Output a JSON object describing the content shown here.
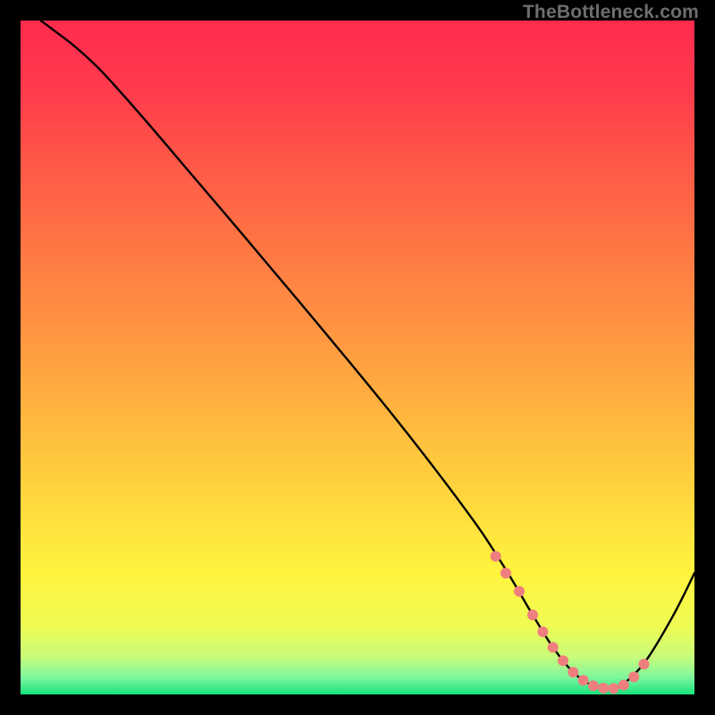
{
  "watermark": "TheBottleneck.com",
  "gradient": {
    "stops": [
      {
        "offset": 0.0,
        "color": "#ff2b4e"
      },
      {
        "offset": 0.1,
        "color": "#ff3a4c"
      },
      {
        "offset": 0.22,
        "color": "#ff5a47"
      },
      {
        "offset": 0.35,
        "color": "#ff7a44"
      },
      {
        "offset": 0.48,
        "color": "#ff9a41"
      },
      {
        "offset": 0.6,
        "color": "#ffba3f"
      },
      {
        "offset": 0.72,
        "color": "#ffda3e"
      },
      {
        "offset": 0.82,
        "color": "#fff43e"
      },
      {
        "offset": 0.9,
        "color": "#eefc55"
      },
      {
        "offset": 0.945,
        "color": "#c7fb7a"
      },
      {
        "offset": 0.975,
        "color": "#7cf79e"
      },
      {
        "offset": 1.0,
        "color": "#18e37a"
      }
    ]
  },
  "chart_data": {
    "type": "line",
    "title": "",
    "xlabel": "",
    "ylabel": "",
    "xlim": [
      0,
      100
    ],
    "ylim": [
      0,
      100
    ],
    "series": [
      {
        "name": "bottleneck-curve",
        "x": [
          3,
          5,
          8,
          12,
          18,
          25,
          33,
          41,
          49,
          56,
          62,
          67.5,
          70,
          73,
          76,
          79,
          82,
          85,
          88,
          90,
          93,
          97,
          100
        ],
        "y": [
          100,
          98.5,
          96.2,
          92.5,
          85.8,
          77.6,
          68.2,
          58.7,
          49.1,
          40.5,
          32.8,
          25.4,
          21.7,
          16.9,
          11.8,
          7.0,
          3.3,
          1.3,
          0.9,
          2.0,
          5.3,
          12.0,
          18.0
        ]
      }
    ],
    "markers": {
      "name": "highlight-points",
      "x": [
        70.5,
        72.0,
        74.0,
        76.0,
        77.5,
        79.0,
        80.5,
        82.0,
        83.5,
        85.0,
        86.5,
        88.0,
        89.5,
        91.0,
        92.5
      ],
      "y": [
        20.5,
        18.0,
        15.3,
        11.8,
        9.3,
        7.0,
        5.0,
        3.3,
        2.1,
        1.3,
        0.95,
        0.9,
        1.4,
        2.6,
        4.5
      ],
      "color": "#ef7f7f",
      "radius": 6
    }
  }
}
